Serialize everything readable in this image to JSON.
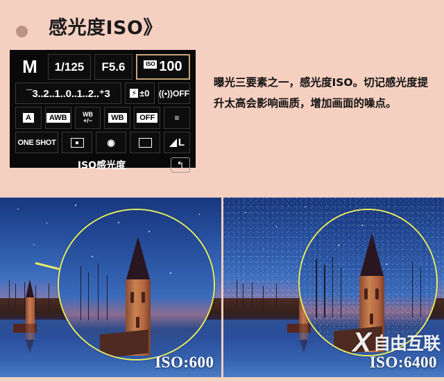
{
  "slide": {
    "background_color": "#f5cfc0",
    "title": "感光度ISO》",
    "bullet": "•"
  },
  "camera_lcd": {
    "panel_color": "#090909",
    "highlight_border_color": "#c8a77a",
    "row1": {
      "mode": "M",
      "shutter_speed": "1/125",
      "aperture": "F5.6",
      "iso_tag": "ISO",
      "iso_value": "100"
    },
    "row2": {
      "exposure_meter": "¯3..2..1..0..1..2..⁺3",
      "flash_icon": "⚡",
      "flash_compensation": "±0",
      "wifi_label": "OFF"
    },
    "row3": {
      "picture_style": "A",
      "white_balance": "AWB",
      "wb_shift_top": "WB",
      "wb_shift_bottom": "+/−",
      "wb_bracket": "WB",
      "peripheral_illum": "OFF",
      "custom_controls": "≡"
    },
    "row4": {
      "af_mode": "ONE SHOT",
      "drive_mode": "□",
      "metering_mode": "◉",
      "af_area": "▭",
      "image_quality": "L"
    },
    "footer_label": "ISO感光度",
    "back_button": "↰"
  },
  "description": "曝光三要素之一，感光度ISO。切记感光度提升太高会影响画质，增加画面的噪点。",
  "comparison": {
    "left_photo": {
      "caption": "ISO:600",
      "noisy": false,
      "magnifier_color": "#e8ef62"
    },
    "right_photo": {
      "caption": "ISO:6400",
      "noisy": true,
      "magnifier_color": "#e8ef62"
    },
    "watermark": {
      "logo": "X",
      "text": "自由互联"
    }
  }
}
